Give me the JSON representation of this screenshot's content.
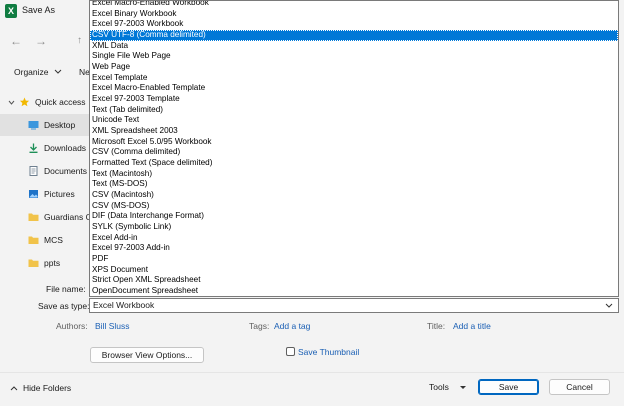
{
  "window": {
    "title": "Save As",
    "app_icon": "X"
  },
  "nav": {
    "back_icon": "←",
    "forward_icon": "→",
    "up_icon": "↑"
  },
  "toolbar": {
    "organize_label": "Organize",
    "new_folder_label": "Ne"
  },
  "sidebar": {
    "items": [
      {
        "label": "Quick access",
        "icon": "star-icon",
        "color": "#f2b800"
      },
      {
        "label": "Desktop",
        "icon": "desktop-icon",
        "color": "#3a96dd"
      },
      {
        "label": "Downloads",
        "icon": "download-icon",
        "color": "#1d8f57"
      },
      {
        "label": "Documents",
        "icon": "documents-icon",
        "color": "#6e7f8f"
      },
      {
        "label": "Pictures",
        "icon": "pictures-icon",
        "color": "#1e73c8"
      },
      {
        "label": "Guardians O",
        "icon": "folder-icon",
        "color": "#f1c34a"
      },
      {
        "label": "MCS",
        "icon": "folder-icon",
        "color": "#f1c34a"
      },
      {
        "label": "ppts",
        "icon": "folder-icon",
        "color": "#f1c34a"
      }
    ]
  },
  "file_types": {
    "options": [
      "Excel Macro-Enabled Workbook",
      "Excel Binary Workbook",
      "Excel 97-2003 Workbook",
      "CSV UTF-8 (Comma delimited)",
      "XML Data",
      "Single File Web Page",
      "Web Page",
      "Excel Template",
      "Excel Macro-Enabled Template",
      "Excel 97-2003 Template",
      "Text (Tab delimited)",
      "Unicode Text",
      "XML Spreadsheet 2003",
      "Microsoft Excel 5.0/95 Workbook",
      "CSV (Comma delimited)",
      "Formatted Text (Space delimited)",
      "Text (Macintosh)",
      "Text (MS-DOS)",
      "CSV (Macintosh)",
      "CSV (MS-DOS)",
      "DIF (Data Interchange Format)",
      "SYLK (Symbolic Link)",
      "Excel Add-in",
      "Excel 97-2003 Add-in",
      "PDF",
      "XPS Document",
      "Strict Open XML Spreadsheet",
      "OpenDocument Spreadsheet"
    ],
    "selected": "CSV UTF-8 (Comma delimited)"
  },
  "form": {
    "file_name_label": "File name:",
    "save_as_type_label": "Save as type:",
    "save_as_type_value": "Excel Workbook",
    "authors_label": "Authors:",
    "authors_value": "Bill Sluss",
    "tags_label": "Tags:",
    "tags_value": "Add a tag",
    "title_label": "Title:",
    "title_value": "Add a title",
    "browser_view_label": "Browser View Options...",
    "save_thumbnail_label": "Save Thumbnail"
  },
  "footer": {
    "hide_folders_label": "Hide Folders",
    "tools_label": "Tools",
    "save_label": "Save",
    "cancel_label": "Cancel"
  },
  "colors": {
    "accent": "#0078d7",
    "link": "#1a5fb4"
  }
}
